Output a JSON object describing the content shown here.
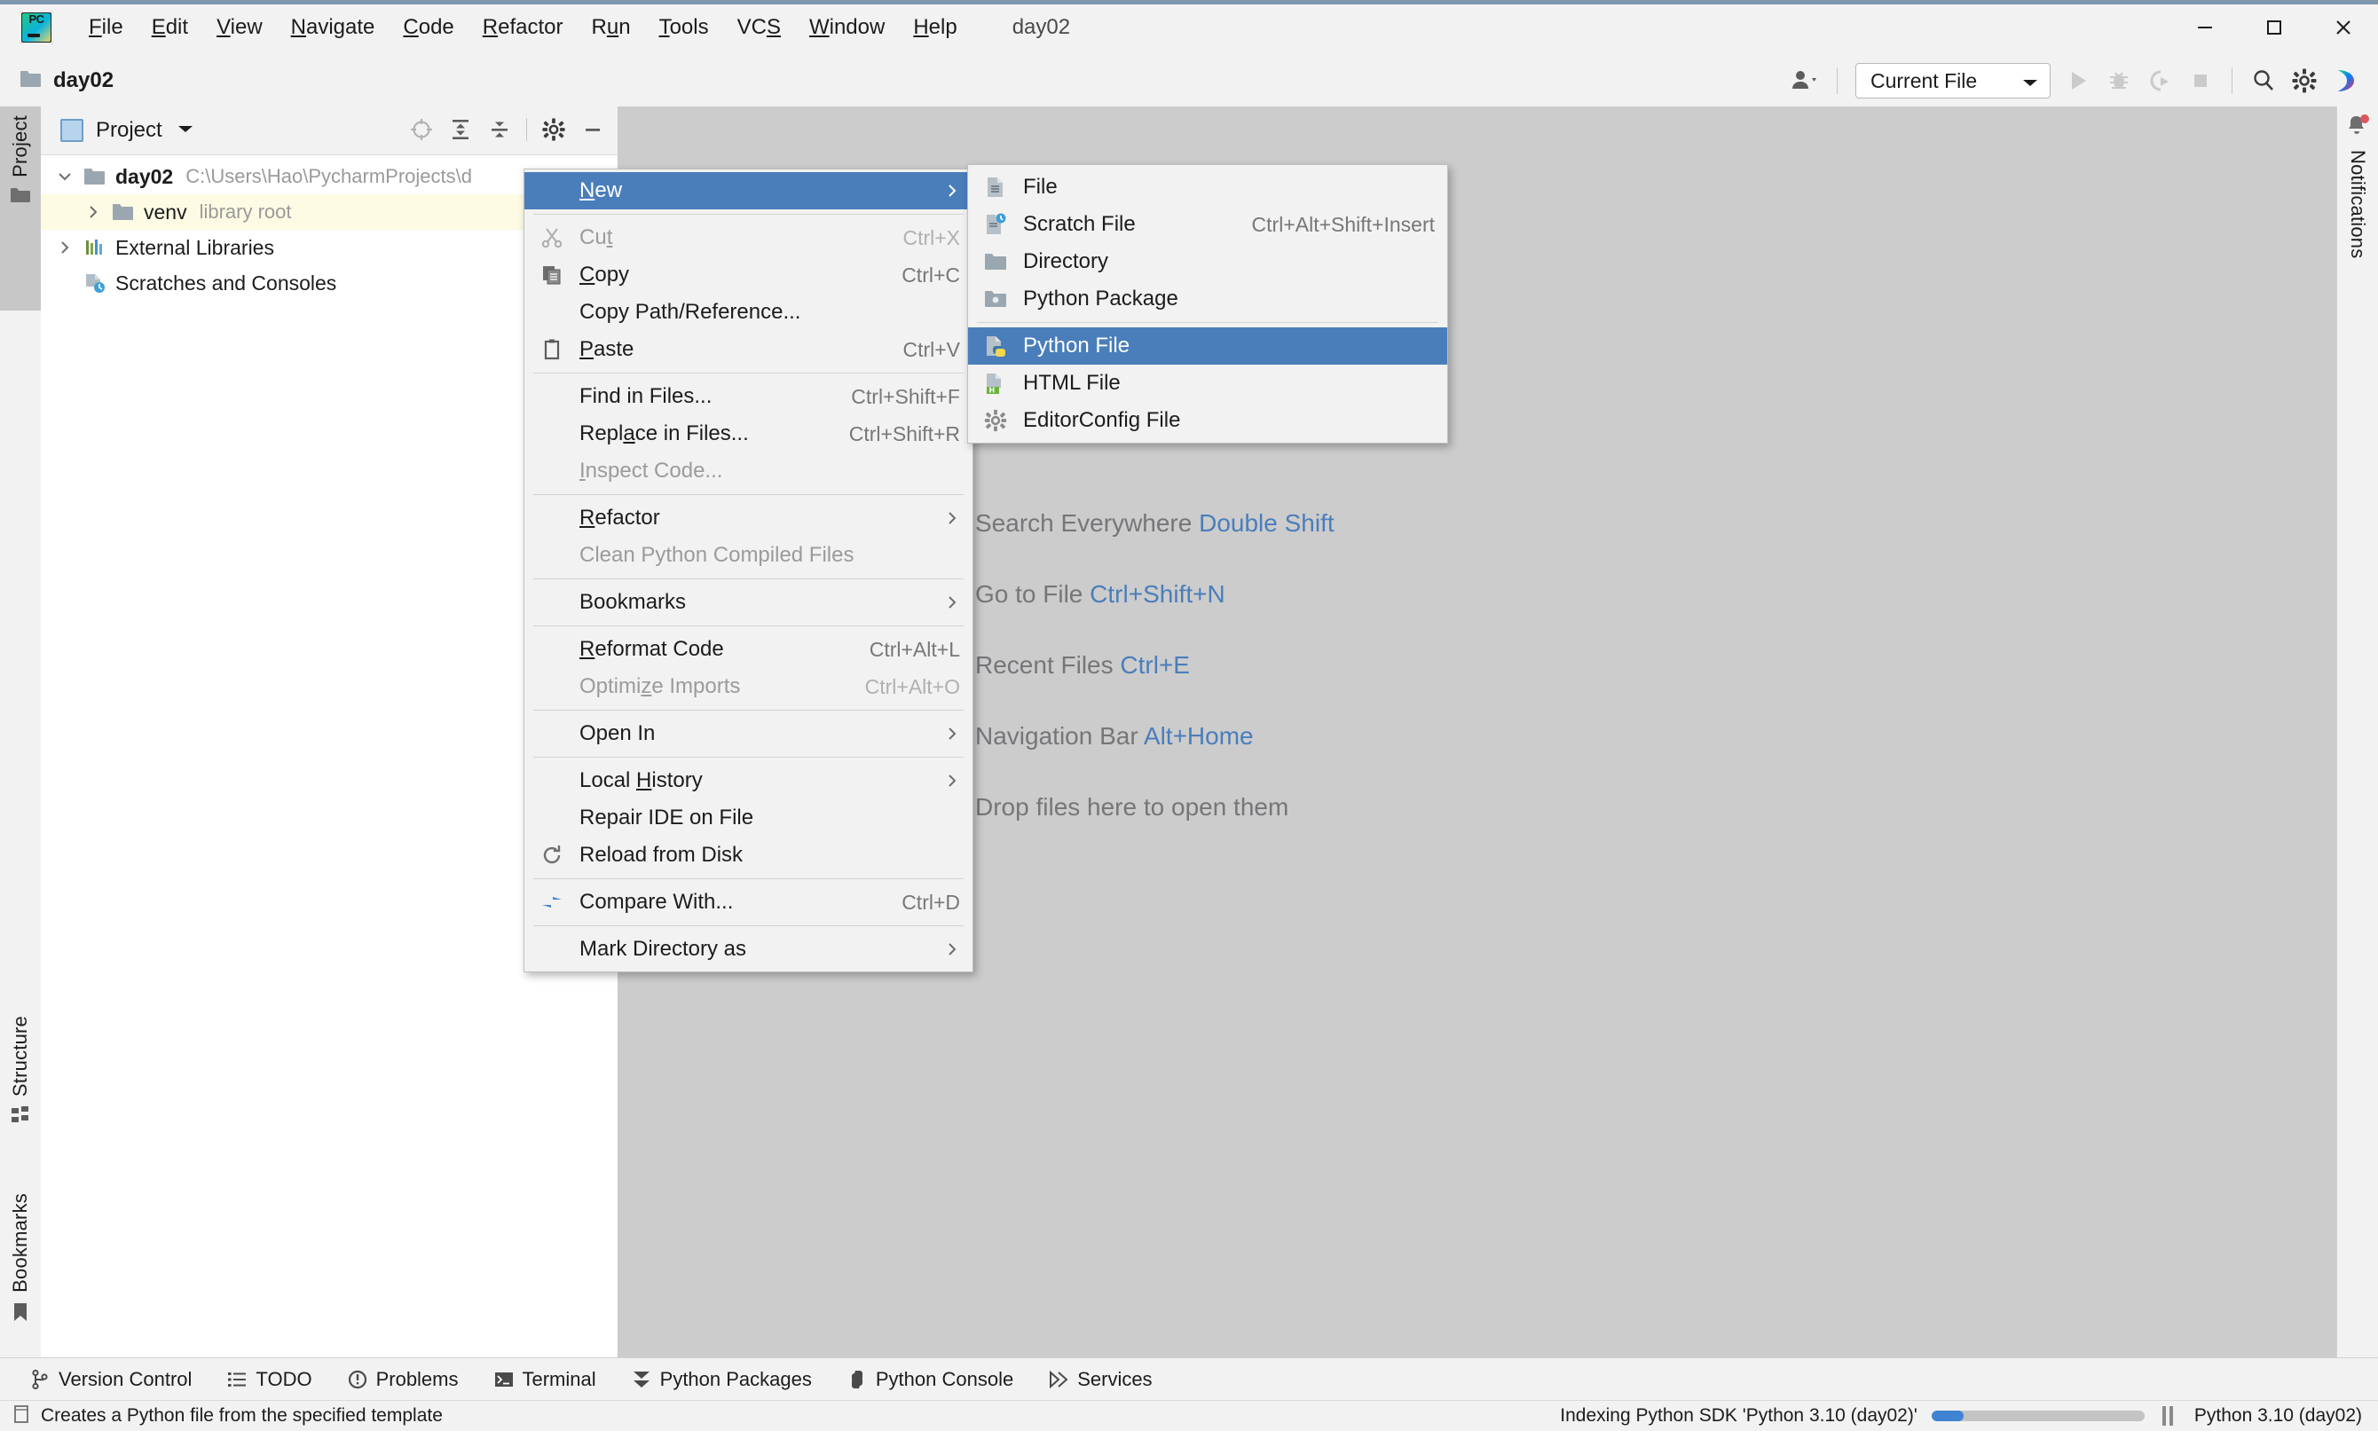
{
  "window": {
    "title": "day02",
    "logo": "pycharm-logo",
    "controls": {
      "minimize": "minimize-icon",
      "maximize": "maximize-icon",
      "close": "close-icon"
    }
  },
  "menubar": {
    "items": [
      {
        "label": "File",
        "pre": "",
        "mnem": "F",
        "post": "ile"
      },
      {
        "label": "Edit",
        "pre": "",
        "mnem": "E",
        "post": "dit"
      },
      {
        "label": "View",
        "pre": "",
        "mnem": "V",
        "post": "iew"
      },
      {
        "label": "Navigate",
        "pre": "",
        "mnem": "N",
        "post": "avigate"
      },
      {
        "label": "Code",
        "pre": "",
        "mnem": "C",
        "post": "ode"
      },
      {
        "label": "Refactor",
        "pre": "",
        "mnem": "R",
        "post": "efactor"
      },
      {
        "label": "Run",
        "pre": "R",
        "mnem": "u",
        "post": "n"
      },
      {
        "label": "Tools",
        "pre": "",
        "mnem": "T",
        "post": "ools"
      },
      {
        "label": "VCS",
        "pre": "VC",
        "mnem": "S",
        "post": ""
      },
      {
        "label": "Window",
        "pre": "",
        "mnem": "W",
        "post": "indow"
      },
      {
        "label": "Help",
        "pre": "",
        "mnem": "H",
        "post": "elp"
      }
    ]
  },
  "toolbar": {
    "breadcrumb": "day02",
    "breadcrumb_icon": "folder-icon",
    "account_icon": "account-icon",
    "run_config": "Current File",
    "run_icon": "run-icon",
    "debug_icon": "debug-icon",
    "coverage_icon": "run-with-coverage-icon",
    "stop_icon": "stop-icon",
    "search_icon": "search-icon",
    "settings_icon": "gear-icon",
    "ai_icon": "ai-assistant-icon"
  },
  "left_stripe": {
    "buttons": [
      {
        "label": "Project",
        "icon": "project-folder-icon",
        "active": true
      },
      {
        "label": "Structure",
        "icon": "structure-icon",
        "active": false
      },
      {
        "label": "Bookmarks",
        "icon": "bookmark-icon",
        "active": false
      }
    ]
  },
  "right_stripe": {
    "notifications": {
      "label": "Notifications",
      "icon": "bell-icon",
      "badge": true
    }
  },
  "project_panel": {
    "title": "Project",
    "tools": [
      {
        "name": "locate-icon",
        "disabled": true
      },
      {
        "name": "expand-all-icon",
        "disabled": false
      },
      {
        "name": "collapse-all-icon",
        "disabled": false
      },
      {
        "name": "gear-icon",
        "disabled": false
      },
      {
        "name": "hide-icon",
        "disabled": false
      }
    ],
    "tree": [
      {
        "label": "day02",
        "sub": "C:\\Users\\Hao\\PycharmProjects\\d",
        "icon": "folder-icon",
        "expanded": true,
        "bold": true,
        "indent": 0,
        "highlight": false
      },
      {
        "label": "venv",
        "sub": "library root",
        "icon": "folder-icon",
        "expanded": false,
        "bold": false,
        "indent": 1,
        "highlight": true
      },
      {
        "label": "External Libraries",
        "sub": "",
        "icon": "libraries-icon",
        "expanded": false,
        "bold": false,
        "indent": 0,
        "highlight": false
      },
      {
        "label": "Scratches and Consoles",
        "sub": "",
        "icon": "scratches-icon",
        "expanded": null,
        "bold": false,
        "indent": 0,
        "highlight": false
      }
    ]
  },
  "context_menu": {
    "items": [
      {
        "label": "New",
        "pre": "",
        "mnem": "N",
        "post": "ew",
        "accel": "",
        "icon": "",
        "arrow": true,
        "selected": true,
        "disabled": false
      },
      {
        "sep": true
      },
      {
        "label": "Cut",
        "pre": "Cu",
        "mnem": "t",
        "post": "",
        "accel": "Ctrl+X",
        "icon": "cut-icon",
        "arrow": false,
        "selected": false,
        "disabled": true
      },
      {
        "label": "Copy",
        "pre": "",
        "mnem": "C",
        "post": "opy",
        "accel": "Ctrl+C",
        "icon": "copy-icon",
        "arrow": false,
        "selected": false,
        "disabled": false
      },
      {
        "label": "Copy Path/Reference...",
        "pre": "Copy Path/Reference...",
        "mnem": "",
        "post": "",
        "accel": "",
        "icon": "",
        "arrow": false,
        "selected": false,
        "disabled": false
      },
      {
        "label": "Paste",
        "pre": "",
        "mnem": "P",
        "post": "aste",
        "accel": "Ctrl+V",
        "icon": "paste-icon",
        "arrow": false,
        "selected": false,
        "disabled": false
      },
      {
        "sep": true
      },
      {
        "label": "Find in Files...",
        "pre": "Find in Files...",
        "mnem": "",
        "post": "",
        "accel": "Ctrl+Shift+F",
        "icon": "",
        "arrow": false,
        "selected": false,
        "disabled": false
      },
      {
        "label": "Replace in Files...",
        "pre": "Repl",
        "mnem": "a",
        "post": "ce in Files...",
        "accel": "Ctrl+Shift+R",
        "icon": "",
        "arrow": false,
        "selected": false,
        "disabled": false
      },
      {
        "label": "Inspect Code...",
        "pre": "",
        "mnem": "I",
        "post": "nspect Code...",
        "accel": "",
        "icon": "",
        "arrow": false,
        "selected": false,
        "disabled": true
      },
      {
        "sep": true
      },
      {
        "label": "Refactor",
        "pre": "",
        "mnem": "R",
        "post": "efactor",
        "accel": "",
        "icon": "",
        "arrow": true,
        "selected": false,
        "disabled": false
      },
      {
        "label": "Clean Python Compiled Files",
        "pre": "Clean Python Compiled Files",
        "mnem": "",
        "post": "",
        "accel": "",
        "icon": "",
        "arrow": false,
        "selected": false,
        "disabled": true
      },
      {
        "sep": true
      },
      {
        "label": "Bookmarks",
        "pre": "Bookmarks",
        "mnem": "",
        "post": "",
        "accel": "",
        "icon": "",
        "arrow": true,
        "selected": false,
        "disabled": false
      },
      {
        "sep": true
      },
      {
        "label": "Reformat Code",
        "pre": "",
        "mnem": "R",
        "post": "eformat Code",
        "accel": "Ctrl+Alt+L",
        "icon": "",
        "arrow": false,
        "selected": false,
        "disabled": false
      },
      {
        "label": "Optimize Imports",
        "pre": "Optimi",
        "mnem": "z",
        "post": "e Imports",
        "accel": "Ctrl+Alt+O",
        "icon": "",
        "arrow": false,
        "selected": false,
        "disabled": true
      },
      {
        "sep": true
      },
      {
        "label": "Open In",
        "pre": "Open In",
        "mnem": "",
        "post": "",
        "accel": "",
        "icon": "",
        "arrow": true,
        "selected": false,
        "disabled": false
      },
      {
        "sep": true
      },
      {
        "label": "Local History",
        "pre": "Local ",
        "mnem": "H",
        "post": "istory",
        "accel": "",
        "icon": "",
        "arrow": true,
        "selected": false,
        "disabled": false
      },
      {
        "label": "Repair IDE on File",
        "pre": "Repair IDE on File",
        "mnem": "",
        "post": "",
        "accel": "",
        "icon": "",
        "arrow": false,
        "selected": false,
        "disabled": false
      },
      {
        "label": "Reload from Disk",
        "pre": "Reload from Disk",
        "mnem": "",
        "post": "",
        "accel": "",
        "icon": "reload-icon",
        "arrow": false,
        "selected": false,
        "disabled": false
      },
      {
        "sep": true
      },
      {
        "label": "Compare With...",
        "pre": "Compare With...",
        "mnem": "",
        "post": "",
        "accel": "Ctrl+D",
        "icon": "compare-icon",
        "arrow": false,
        "selected": false,
        "disabled": false
      },
      {
        "sep": true
      },
      {
        "label": "Mark Directory as",
        "pre": "Mark Directory as",
        "mnem": "",
        "post": "",
        "accel": "",
        "icon": "",
        "arrow": true,
        "selected": false,
        "disabled": false
      }
    ]
  },
  "new_submenu": {
    "items": [
      {
        "label": "File",
        "accel": "",
        "icon": "file-icon",
        "selected": false
      },
      {
        "label": "Scratch File",
        "accel": "Ctrl+Alt+Shift+Insert",
        "icon": "scratch-file-icon",
        "selected": false
      },
      {
        "label": "Directory",
        "accel": "",
        "icon": "directory-icon",
        "selected": false
      },
      {
        "label": "Python Package",
        "accel": "",
        "icon": "python-package-icon",
        "selected": false
      },
      {
        "sep": true
      },
      {
        "label": "Python File",
        "accel": "",
        "icon": "python-file-icon",
        "selected": true
      },
      {
        "label": "HTML File",
        "accel": "",
        "icon": "html-file-icon",
        "selected": false
      },
      {
        "label": "EditorConfig File",
        "accel": "",
        "icon": "editorconfig-icon",
        "selected": false
      }
    ]
  },
  "editor_hints": [
    {
      "text": "Search Everywhere ",
      "shortcut": "Double Shift"
    },
    {
      "text": "Go to File ",
      "shortcut": "Ctrl+Shift+N"
    },
    {
      "text": "Recent Files ",
      "shortcut": "Ctrl+E"
    },
    {
      "text": "Navigation Bar ",
      "shortcut": "Alt+Home"
    },
    {
      "text": "Drop files here to open them",
      "shortcut": ""
    }
  ],
  "tool_window_bar": {
    "items": [
      {
        "label": "Version Control",
        "icon": "version-control-icon"
      },
      {
        "label": "TODO",
        "icon": "todo-icon"
      },
      {
        "label": "Problems",
        "icon": "problems-icon"
      },
      {
        "label": "Terminal",
        "icon": "terminal-icon"
      },
      {
        "label": "Python Packages",
        "icon": "python-packages-icon"
      },
      {
        "label": "Python Console",
        "icon": "python-console-icon"
      },
      {
        "label": "Services",
        "icon": "services-icon"
      }
    ]
  },
  "status_bar": {
    "icon": "status-doc-icon",
    "message": "Creates a Python file from the specified template",
    "indexing": "Indexing Python SDK 'Python 3.10 (day02)'",
    "progress_percent": 15,
    "pause_icon": "pause-icon",
    "interpreter": "Python 3.10 (day02)"
  },
  "colors": {
    "selection_blue": "#4a7ebb",
    "shortcut_blue": "#4a7ebb",
    "panel_bg": "#f2f2f2",
    "editor_bg": "#cccccc",
    "tree_highlight": "#fdfbe3",
    "progress_fill": "#3f84d2",
    "badge_red": "#db5860"
  }
}
